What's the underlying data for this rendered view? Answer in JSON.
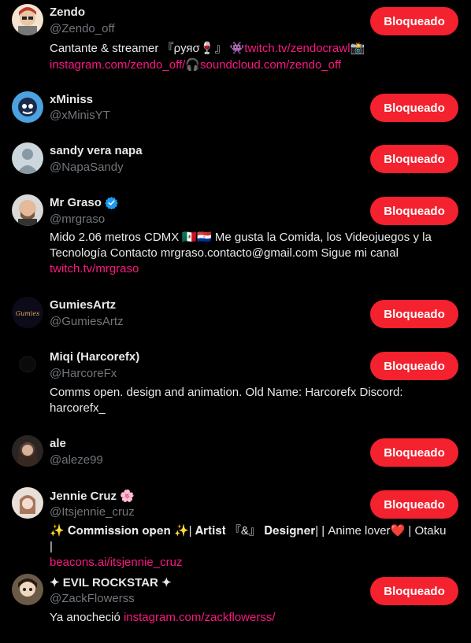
{
  "users": [
    {
      "name": "Zendo",
      "handle": "@Zendo_off",
      "button": "Bloqueado",
      "bio_parts": [
        {
          "text": "Cantante & streamer 『ρуяσ🍷』 ",
          "link": false
        },
        {
          "text": "👾 ",
          "link": false
        },
        {
          "text": "twitch.tv/zendocrawl",
          "link": true
        },
        {
          "text": " 📸 ",
          "link": false
        },
        {
          "text": "instagram.com/zendo_off/",
          "link": true
        },
        {
          "text": " 🎧 ",
          "link": false
        },
        {
          "text": "soundcloud.com/zendo_off",
          "link": true
        }
      ]
    },
    {
      "name": "xMiniss",
      "handle": "@xMinisYT",
      "button": "Bloqueado",
      "bio_parts": []
    },
    {
      "name": "sandy vera napa",
      "handle": "@NapaSandy",
      "button": "Bloqueado",
      "bio_parts": []
    },
    {
      "name": "Mr Graso",
      "handle": "@mrgraso",
      "button": "Bloqueado",
      "verified": true,
      "bio_parts": [
        {
          "text": "Mido 2.06 metros CDMX 🇲🇽🇵🇾 Me gusta la Comida, los Videojuegos y la Tecnología Contacto mrgraso.contacto@gmail.com Sigue mi canal ",
          "link": false
        },
        {
          "text": "twitch.tv/mrgraso",
          "link": true
        }
      ]
    },
    {
      "name": "GumiesArtz",
      "handle": "@GumiesArtz",
      "button": "Bloqueado",
      "bio_parts": []
    },
    {
      "name": "Miqi (Harcorefx)",
      "handle": "@HarcoreFx",
      "button": "Bloqueado",
      "bio_parts": [
        {
          "text": "Comms open. design and animation. Old Name: Harcorefx Discord: harcorefx_",
          "link": false
        }
      ]
    },
    {
      "name": "ale",
      "handle": "@aleze99",
      "button": "Bloqueado",
      "bio_parts": []
    },
    {
      "name": "Jennie Cruz 🌸",
      "handle": "@Itsjennie_cruz",
      "button": "Bloqueado",
      "bio_parts": [
        {
          "text": "✨ 𝐂𝐨𝐦𝐦𝐢𝐬𝐬𝐢𝐨𝐧 𝐨𝐩𝐞𝐧 ✨| 𝐀𝐫𝐭𝐢𝐬𝐭 『&』 𝐃𝐞𝐬𝐢𝐠𝐧𝐞𝐫| | Anime lover❤️ | Otaku | ",
          "link": false
        },
        {
          "text": "beacons.ai/itsjennie_cruz",
          "link": true
        }
      ]
    },
    {
      "name": "✦ EVIL ROCKSTAR ✦",
      "handle": "@ZackFlowerss",
      "button": "Bloqueado",
      "bio_parts": [
        {
          "text": "Ya anocheció ",
          "link": false
        },
        {
          "text": "instagram.com/zackflowerss/",
          "link": true
        }
      ]
    }
  ],
  "colors": {
    "background": "#000000",
    "button": "#f4212e",
    "link": "#f91880",
    "muted": "#71767b",
    "verified": "#1d9bf0"
  }
}
